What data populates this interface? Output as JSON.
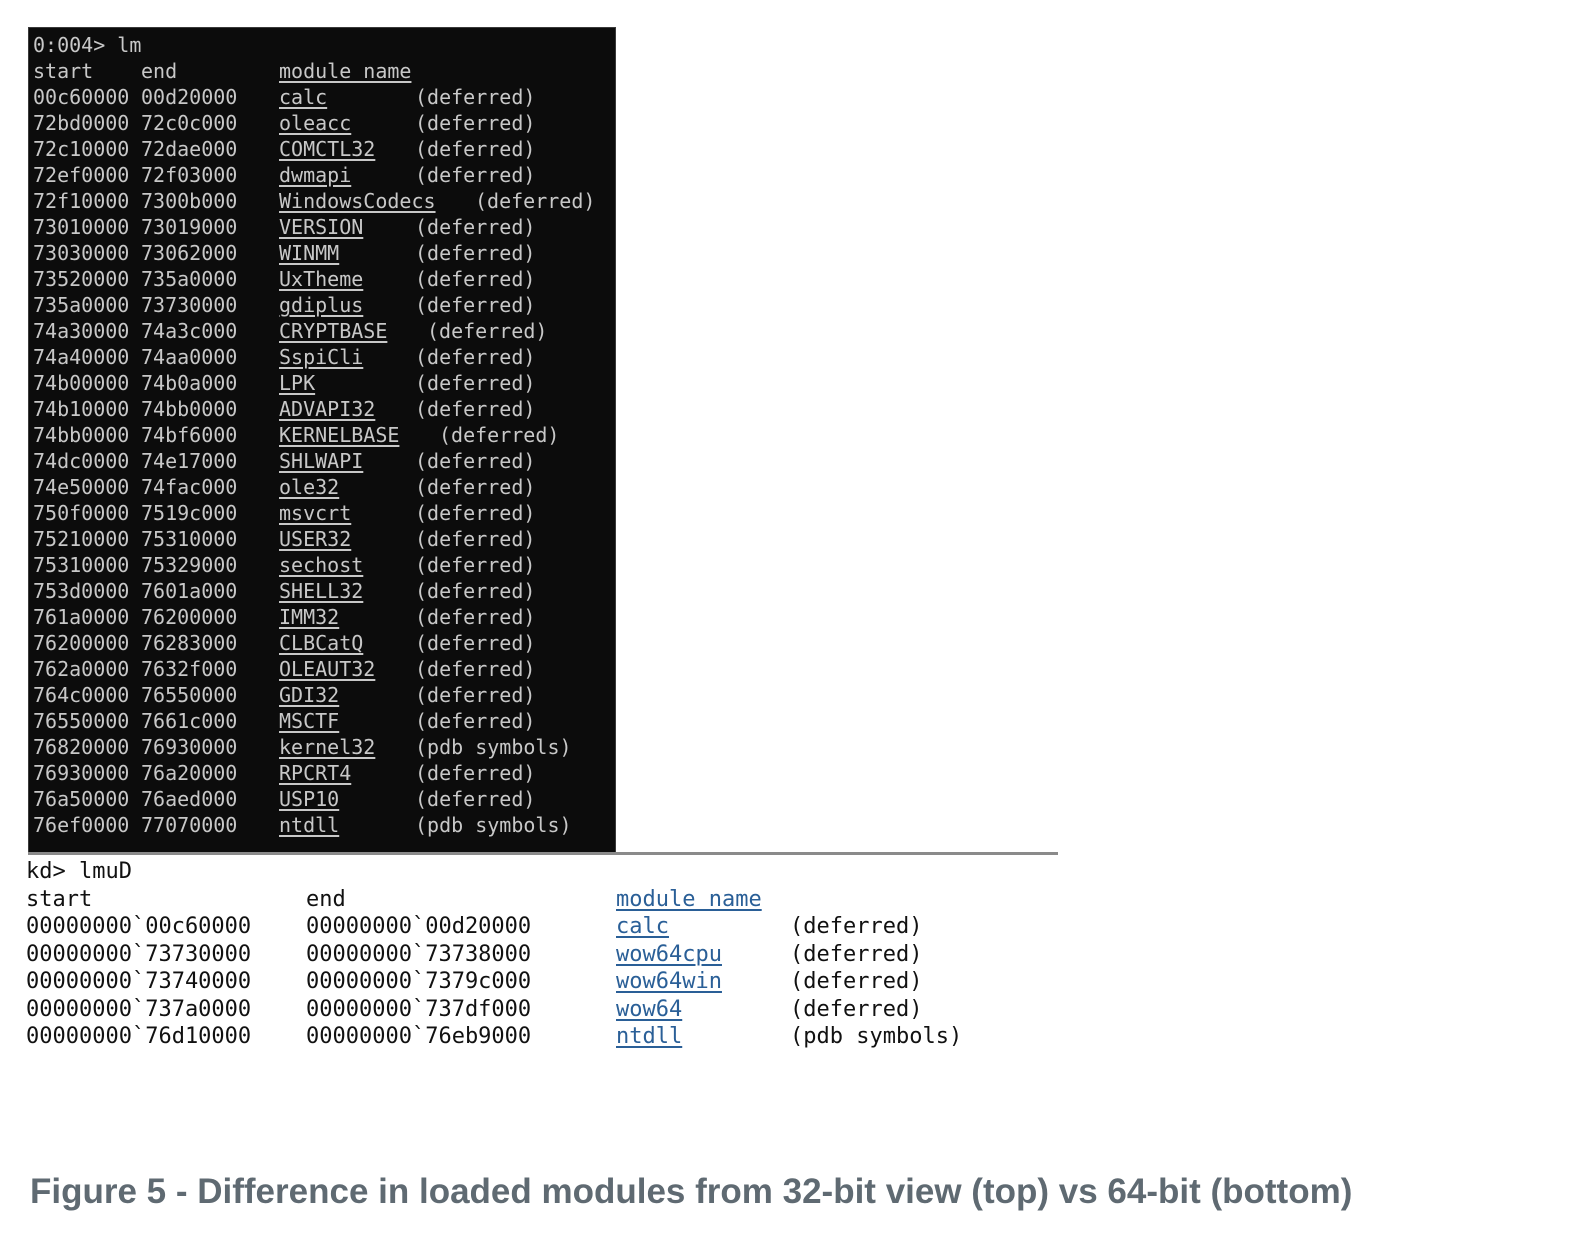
{
  "console32": {
    "prompt": "0:004> lm",
    "headers": {
      "start": "start",
      "end": "end",
      "module": "module name"
    },
    "rows": [
      {
        "start": "00c60000",
        "end": "00d20000",
        "module": "calc",
        "status": "(deferred)"
      },
      {
        "start": "72bd0000",
        "end": "72c0c000",
        "module": "oleacc",
        "status": "(deferred)"
      },
      {
        "start": "72c10000",
        "end": "72dae000",
        "module": "COMCTL32",
        "status": "(deferred)"
      },
      {
        "start": "72ef0000",
        "end": "72f03000",
        "module": "dwmapi",
        "status": "(deferred)"
      },
      {
        "start": "72f10000",
        "end": "7300b000",
        "module": "WindowsCodecs",
        "status": "(deferred)"
      },
      {
        "start": "73010000",
        "end": "73019000",
        "module": "VERSION",
        "status": "(deferred)"
      },
      {
        "start": "73030000",
        "end": "73062000",
        "module": "WINMM",
        "status": "(deferred)"
      },
      {
        "start": "73520000",
        "end": "735a0000",
        "module": "UxTheme",
        "status": "(deferred)"
      },
      {
        "start": "735a0000",
        "end": "73730000",
        "module": "gdiplus",
        "status": "(deferred)"
      },
      {
        "start": "74a30000",
        "end": "74a3c000",
        "module": "CRYPTBASE",
        "status": "(deferred)"
      },
      {
        "start": "74a40000",
        "end": "74aa0000",
        "module": "SspiCli",
        "status": "(deferred)"
      },
      {
        "start": "74b00000",
        "end": "74b0a000",
        "module": "LPK",
        "status": "(deferred)"
      },
      {
        "start": "74b10000",
        "end": "74bb0000",
        "module": "ADVAPI32",
        "status": "(deferred)"
      },
      {
        "start": "74bb0000",
        "end": "74bf6000",
        "module": "KERNELBASE",
        "status": "(deferred)"
      },
      {
        "start": "74dc0000",
        "end": "74e17000",
        "module": "SHLWAPI",
        "status": "(deferred)"
      },
      {
        "start": "74e50000",
        "end": "74fac000",
        "module": "ole32",
        "status": "(deferred)"
      },
      {
        "start": "750f0000",
        "end": "7519c000",
        "module": "msvcrt",
        "status": "(deferred)"
      },
      {
        "start": "75210000",
        "end": "75310000",
        "module": "USER32",
        "status": "(deferred)"
      },
      {
        "start": "75310000",
        "end": "75329000",
        "module": "sechost",
        "status": "(deferred)"
      },
      {
        "start": "753d0000",
        "end": "7601a000",
        "module": "SHELL32",
        "status": "(deferred)"
      },
      {
        "start": "761a0000",
        "end": "76200000",
        "module": "IMM32",
        "status": "(deferred)"
      },
      {
        "start": "76200000",
        "end": "76283000",
        "module": "CLBCatQ",
        "status": "(deferred)"
      },
      {
        "start": "762a0000",
        "end": "7632f000",
        "module": "OLEAUT32",
        "status": "(deferred)"
      },
      {
        "start": "764c0000",
        "end": "76550000",
        "module": "GDI32",
        "status": "(deferred)"
      },
      {
        "start": "76550000",
        "end": "7661c000",
        "module": "MSCTF",
        "status": "(deferred)"
      },
      {
        "start": "76820000",
        "end": "76930000",
        "module": "kernel32",
        "status": "(pdb symbols)"
      },
      {
        "start": "76930000",
        "end": "76a20000",
        "module": "RPCRT4",
        "status": "(deferred)"
      },
      {
        "start": "76a50000",
        "end": "76aed000",
        "module": "USP10",
        "status": "(deferred)"
      },
      {
        "start": "76ef0000",
        "end": "77070000",
        "module": "ntdll",
        "status": "(pdb symbols)"
      }
    ]
  },
  "kd64": {
    "prompt": "kd> lmuD",
    "headers": {
      "start": "start",
      "end": "end",
      "module": "module name"
    },
    "rows": [
      {
        "start": "00000000`00c60000",
        "end": "00000000`00d20000",
        "module": "calc",
        "status": "(deferred)"
      },
      {
        "start": "00000000`73730000",
        "end": "00000000`73738000",
        "module": "wow64cpu",
        "status": "(deferred)"
      },
      {
        "start": "00000000`73740000",
        "end": "00000000`7379c000",
        "module": "wow64win",
        "status": "(deferred)"
      },
      {
        "start": "00000000`737a0000",
        "end": "00000000`737df000",
        "module": "wow64",
        "status": "(deferred)"
      },
      {
        "start": "00000000`76d10000",
        "end": "00000000`76eb9000",
        "module": "ntdll",
        "status": "(pdb symbols)"
      }
    ]
  },
  "caption": "Figure 5 - Difference in loaded modules from 32-bit view (top) vs 64-bit (bottom)",
  "colors": {
    "console_bg": "#0c0c0c",
    "console_text": "#c8c8c8",
    "link_blue": "#2a5f97",
    "caption_gray": "#5f6a72"
  }
}
